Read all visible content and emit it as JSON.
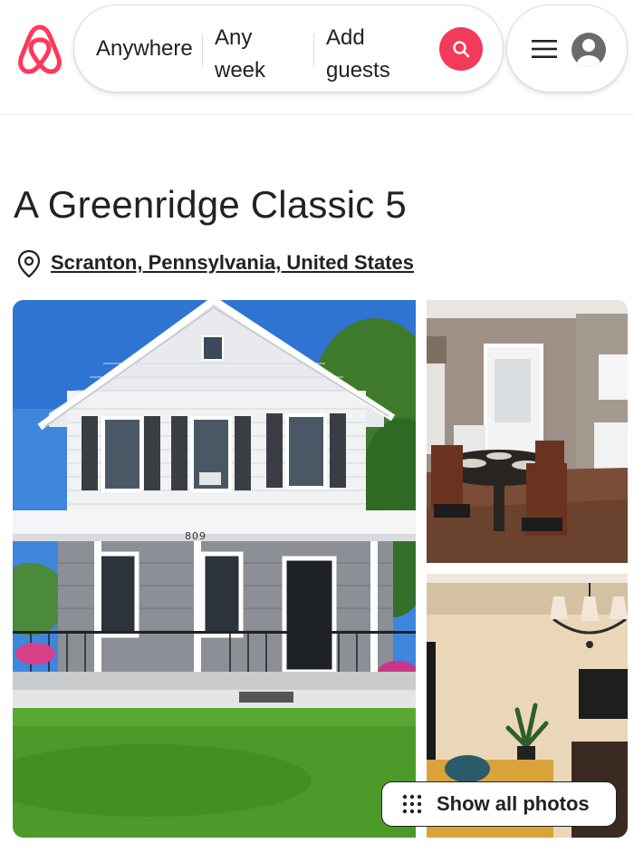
{
  "header": {
    "search": {
      "location_label": "Anywhere",
      "date_label": "Any week",
      "guests_label": "Add guests"
    }
  },
  "listing": {
    "title": "A Greenridge Classic 5",
    "location": "Scranton, Pennsylvania, United States"
  },
  "photos": {
    "house_number": "809",
    "show_all_label": "Show all photos"
  },
  "colors": {
    "brand": "#ff385c",
    "search_button": "#f23a5b",
    "text": "#222222"
  },
  "icons": [
    "airbnb-logo-icon",
    "search-icon",
    "menu-icon",
    "user-avatar-icon",
    "map-pin-icon",
    "grid-dots-icon"
  ]
}
